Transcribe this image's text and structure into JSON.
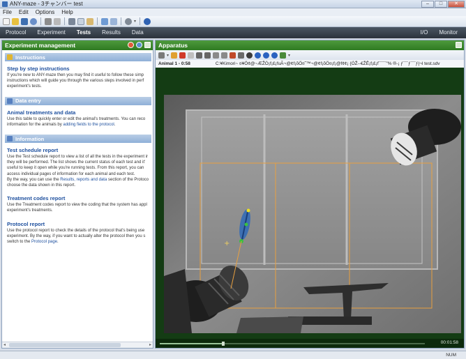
{
  "window": {
    "title": "ANY-maze - 3チャンバー test"
  },
  "menu": [
    "File",
    "Edit",
    "Options",
    "Help"
  ],
  "nav": {
    "tabs": [
      "Protocol",
      "Experiment",
      "Tests",
      "Results",
      "Data"
    ],
    "active": "Tests",
    "right": [
      "I/O",
      "Monitor"
    ]
  },
  "left_pane": {
    "title": "Experiment management",
    "sections": [
      {
        "header": "Instructions",
        "items": [
          {
            "title": "Step by step instructions",
            "lines": [
              "If you're new to ANY-maze then you may find it useful to follow these simp",
              "instructions which will  guide you through the various steps involved in perf",
              "experiment's tests."
            ]
          }
        ]
      },
      {
        "header": "Data entry",
        "items": [
          {
            "title": "Animal treatments and data",
            "lines": [
              "Use this table to quickly enter or edit the animal's treatments.  You can reco",
              "information for the animals by ",
              "."
            ],
            "link": "adding fields to the protocol"
          }
        ]
      },
      {
        "header": "Information",
        "items": [
          {
            "title": "Test schedule report",
            "lines": [
              "Use the Test schedule report to view a list of all the tests in the experiment ir",
              "they will be performed.  The list shows the current status of each test and it'",
              "useful to keep it open while you're running tests.  From this report, you can",
              "access individual pages of information for each animal and each test.",
              "By the way, you can use the ",
              " section of the Protoco",
              "choose the data shown in this report."
            ],
            "link": "Results, reports and data"
          },
          {
            "title": "Treatment codes report",
            "lines": [
              "Use the Treatment codes report to view the coding that the system has appl",
              "experiment's treatments."
            ]
          },
          {
            "title": "Protocol report",
            "lines": [
              "Use the protocol report to check the details of the protocol that's being use",
              "experiment.  By the way, if you want to actually alter the protocol then you s",
              "switch to the ",
              "."
            ],
            "link": "Protocol page"
          }
        ]
      }
    ]
  },
  "right_pane": {
    "title": "Apparatus",
    "animal": "Animal 1 - 0:58",
    "path": "C:¥Kimori~ ¤¥Ö¢@~ÆŽÒ¡f¡£¡fuÃ¬@¢f¡õÖ¤˜™¬@¢f¡õÖ¤¡f¡@f¢¢¡ {ÓŽ--€ŽÊ¡f¡£¡f¯¯¯\"% ®-¡ ƒ¯¯ƒ¯¯ƒ|¬l test.sdv",
    "time": "00:01:58",
    "progress": 0.24
  },
  "status": {
    "num": "NUM"
  },
  "colors": {
    "nav_bg": "#2c333c",
    "pane_header": "#2f7a22",
    "link": "#1d4f9e",
    "section_header": "#8fb0d8",
    "video_bg": "#143c14",
    "zone_lines": "#e8a040"
  },
  "icons": [
    "new-icon",
    "open-icon",
    "save-icon",
    "print-icon",
    "cut-icon",
    "copy-icon",
    "paste-icon",
    "play-icon",
    "stop-icon",
    "record-icon",
    "undo-icon",
    "redo-icon",
    "help-icon"
  ]
}
